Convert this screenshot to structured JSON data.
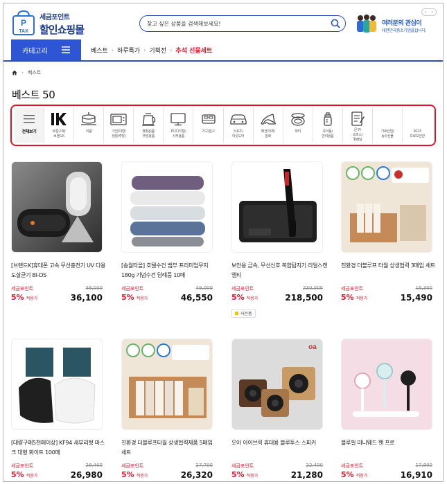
{
  "header": {
    "logo_sub": "세금포인트",
    "logo_main": "할인쇼핑몰",
    "logo_badge_top": "P",
    "logo_badge_bottom": "TAX",
    "search_placeholder": "찾고 싶은 상품을 검색해보세요!",
    "ad_title": "여러분의 관심이",
    "ad_sub": "대한민국중소기업을삽니다.",
    "ad_prev": "‹",
    "ad_next": "›"
  },
  "nav": {
    "category_label": "카테고리",
    "links": [
      "베스트",
      "하루특가",
      "기획전",
      "추석 선물세트"
    ]
  },
  "breadcrumb": {
    "current": "베스트"
  },
  "page_title": "베스트 50",
  "categories": [
    {
      "label": "전체보기",
      "icon": "menu-lines-icon"
    },
    {
      "label": "로컬구매/\n브랜드K",
      "icon": "brand-k-icon"
    },
    {
      "label": "식품",
      "icon": "cake-icon"
    },
    {
      "label": "가전(대형/\n생활/주방)",
      "icon": "microwave-icon"
    },
    {
      "label": "생활용품/\n주방용품",
      "icon": "kettle-icon"
    },
    {
      "label": "PC/디지털/\n사무용품",
      "icon": "monitor-icon"
    },
    {
      "label": "가구/침구",
      "icon": "bed-icon"
    },
    {
      "label": "스포츠/\n아웃도어",
      "icon": "car-icon"
    },
    {
      "label": "패션/의류/\n잡화",
      "icon": "heel-icon"
    },
    {
      "label": "뷰티",
      "icon": "compact-icon"
    },
    {
      "label": "유아동/\n반려용품",
      "icon": "baby-bottle-icon"
    },
    {
      "label": "문구/\n오피스/\n꽃배달",
      "icon": "notepad-icon"
    },
    {
      "label": "가로산업/\n농수산물",
      "icon": "none"
    },
    {
      "label": "2023\n프로모션관",
      "icon": "none"
    }
  ],
  "seller_label": "세금포인트",
  "discount_label": "적용가",
  "products": [
    {
      "name": "[브랜드K]휴대폰 고속 무선충전기 UV 다용도살균기 BI-DS",
      "orig": "38,000",
      "disc": "5%",
      "price": "36,100",
      "img": "charger"
    },
    {
      "name": "[송월타올] 호텔수건 뱀부 프리미엄무지 180g 기념수건 답례품 10매",
      "orig": "49,000",
      "disc": "5%",
      "price": "46,550",
      "img": "towels"
    },
    {
      "name": "보안용 금속, 무선신호 복합탐지기 리얼스캔 엠티",
      "orig": "230,000",
      "disc": "5%",
      "price": "218,500",
      "img": "detector",
      "gift": "사은품"
    },
    {
      "name": "친환경 더블루프 타월 상생협력 3매입 세트",
      "orig": "16,300",
      "disc": "5%",
      "price": "15,490",
      "img": "towelbox"
    },
    {
      "name": "[대량구매5천매이상] KF94 새부리형 마스크 대형 화이트 100매",
      "orig": "28,400",
      "disc": "5%",
      "price": "26,980",
      "img": "masks"
    },
    {
      "name": "친환경 더블루프타월 상생협력제품 5매입 세트",
      "orig": "27,700",
      "disc": "5%",
      "price": "26,320",
      "img": "towelbox5"
    },
    {
      "name": "오아 아이브릭 휴대용 블루투스 스피커",
      "orig": "22,400",
      "disc": "5%",
      "price": "21,280",
      "img": "speakers"
    },
    {
      "name": "블루필 미니웨드 핸 프로",
      "orig": "17,800",
      "disc": "5%",
      "price": "16,910",
      "img": "fans"
    }
  ]
}
